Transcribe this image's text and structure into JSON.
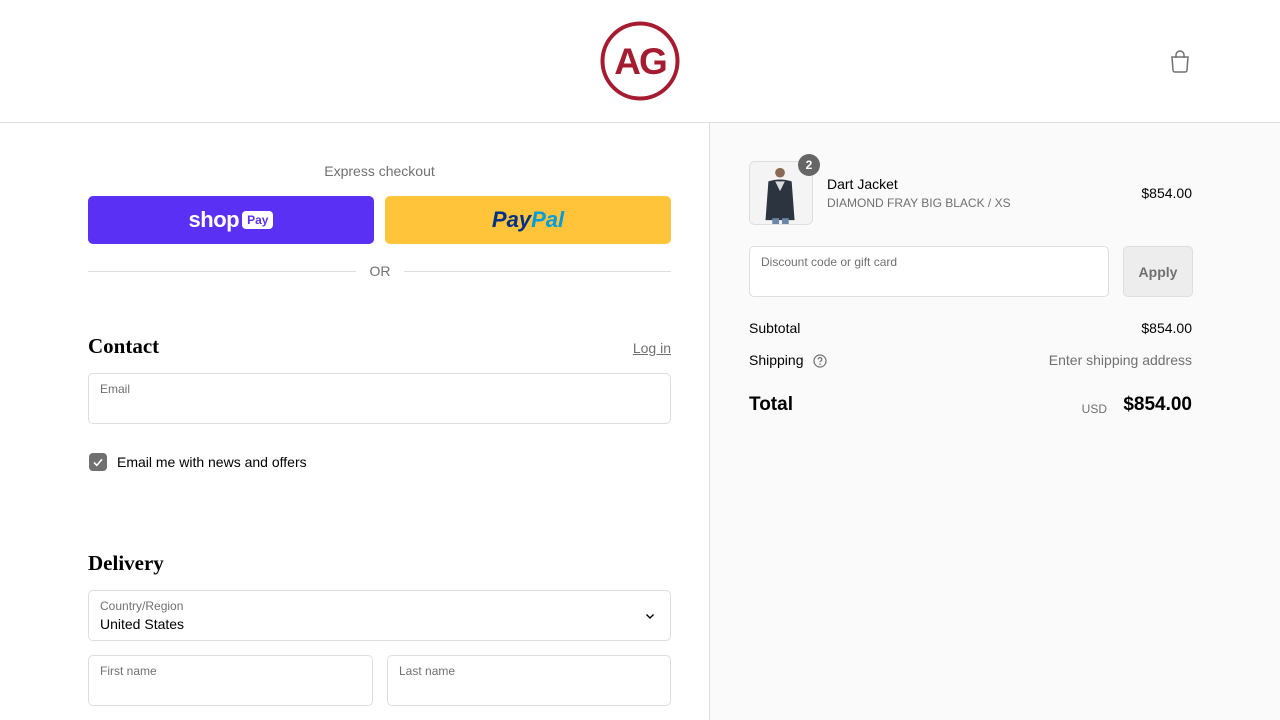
{
  "header": {
    "logo_text": "AG",
    "brand_color": "#a51c30"
  },
  "express": {
    "label": "Express checkout",
    "shop_text": "shop",
    "shop_pay_text": "Pay",
    "paypal_text_a": "Pay",
    "paypal_text_b": "Pal",
    "or_text": "OR"
  },
  "contact": {
    "title": "Contact",
    "login": "Log in",
    "email_label": "Email",
    "email_value": "",
    "newsletter_label": "Email me with news and offers",
    "newsletter_checked": true
  },
  "delivery": {
    "title": "Delivery",
    "country_label": "Country/Region",
    "country_value": "United States",
    "first_name_label": "First name",
    "last_name_label": "Last name"
  },
  "summary": {
    "item": {
      "name": "Dart Jacket",
      "variant": "DIAMOND FRAY BIG BLACK / XS",
      "price": "$854.00",
      "quantity": "2"
    },
    "discount_label": "Discount code or gift card",
    "apply_label": "Apply",
    "subtotal_label": "Subtotal",
    "subtotal_value": "$854.00",
    "shipping_label": "Shipping",
    "shipping_value": "Enter shipping address",
    "total_label": "Total",
    "total_currency": "USD",
    "total_value": "$854.00"
  },
  "colors": {
    "shop_pay": "#5a31f4",
    "paypal": "#ffc439",
    "muted": "#707070",
    "border": "#dedede"
  }
}
